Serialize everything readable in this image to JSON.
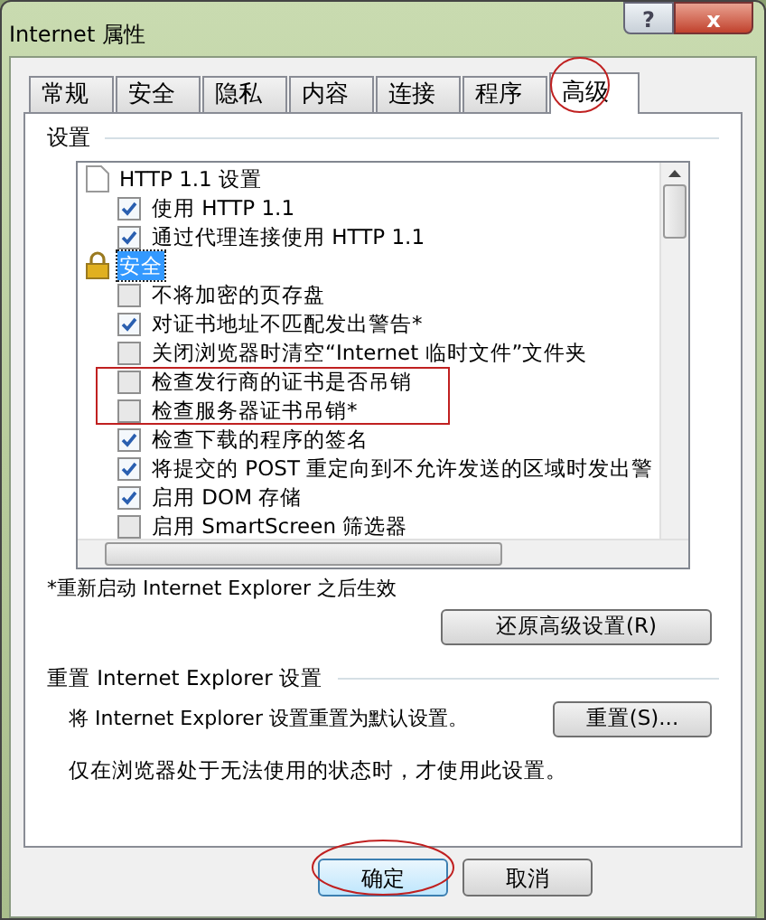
{
  "window": {
    "title": "Internet 属性",
    "buttons": [
      "?",
      "x"
    ]
  },
  "tabs": [
    {
      "label": "常规",
      "selected": false
    },
    {
      "label": "安全",
      "selected": false
    },
    {
      "label": "隐私",
      "selected": false
    },
    {
      "label": "内容",
      "selected": false
    },
    {
      "label": "连接",
      "selected": false
    },
    {
      "label": "程序",
      "selected": false
    },
    {
      "label": "高级",
      "selected": true
    }
  ],
  "settings": {
    "label": "设置",
    "tree": [
      {
        "label": "HTTP 1.1 设置",
        "kind": "page",
        "selected": false,
        "children": [
          {
            "label": "使用 HTTP 1.1",
            "checked": true
          },
          {
            "label": "通过代理连接使用 HTTP 1.1",
            "checked": true
          }
        ]
      },
      {
        "label": "安全",
        "kind": "lock",
        "selected": true,
        "children": [
          {
            "label": "不将加密的页存盘",
            "checked": false
          },
          {
            "label": "对证书地址不匹配发出警告*",
            "checked": true
          },
          {
            "label": "关闭浏览器时清空“Internet 临时文件”文件夹",
            "checked": false
          },
          {
            "label": "检查发行商的证书是否吊销",
            "checked": false
          },
          {
            "label": "检查服务器证书吊销*",
            "checked": false
          },
          {
            "label": "检查下载的程序的签名",
            "checked": true
          },
          {
            "label": "将提交的 POST 重定向到不允许发送的区域时发出警",
            "checked": true
          },
          {
            "label": "启用 DOM 存储",
            "checked": true
          },
          {
            "label": "启用 SmartScreen 筛选器",
            "checked": false
          }
        ]
      }
    ]
  },
  "note": "*重新启动 Internet Explorer 之后生效",
  "restore_button": "还原高级设置(R)",
  "reset": {
    "title": "重置 Internet Explorer 设置",
    "description": "将 Internet Explorer 设置重置为默认设置。",
    "button": "重置(S)...",
    "hint": "仅在浏览器处于无法使用的状态时，才使用此设置。"
  },
  "buttons": [
    "确定",
    "取消"
  ]
}
